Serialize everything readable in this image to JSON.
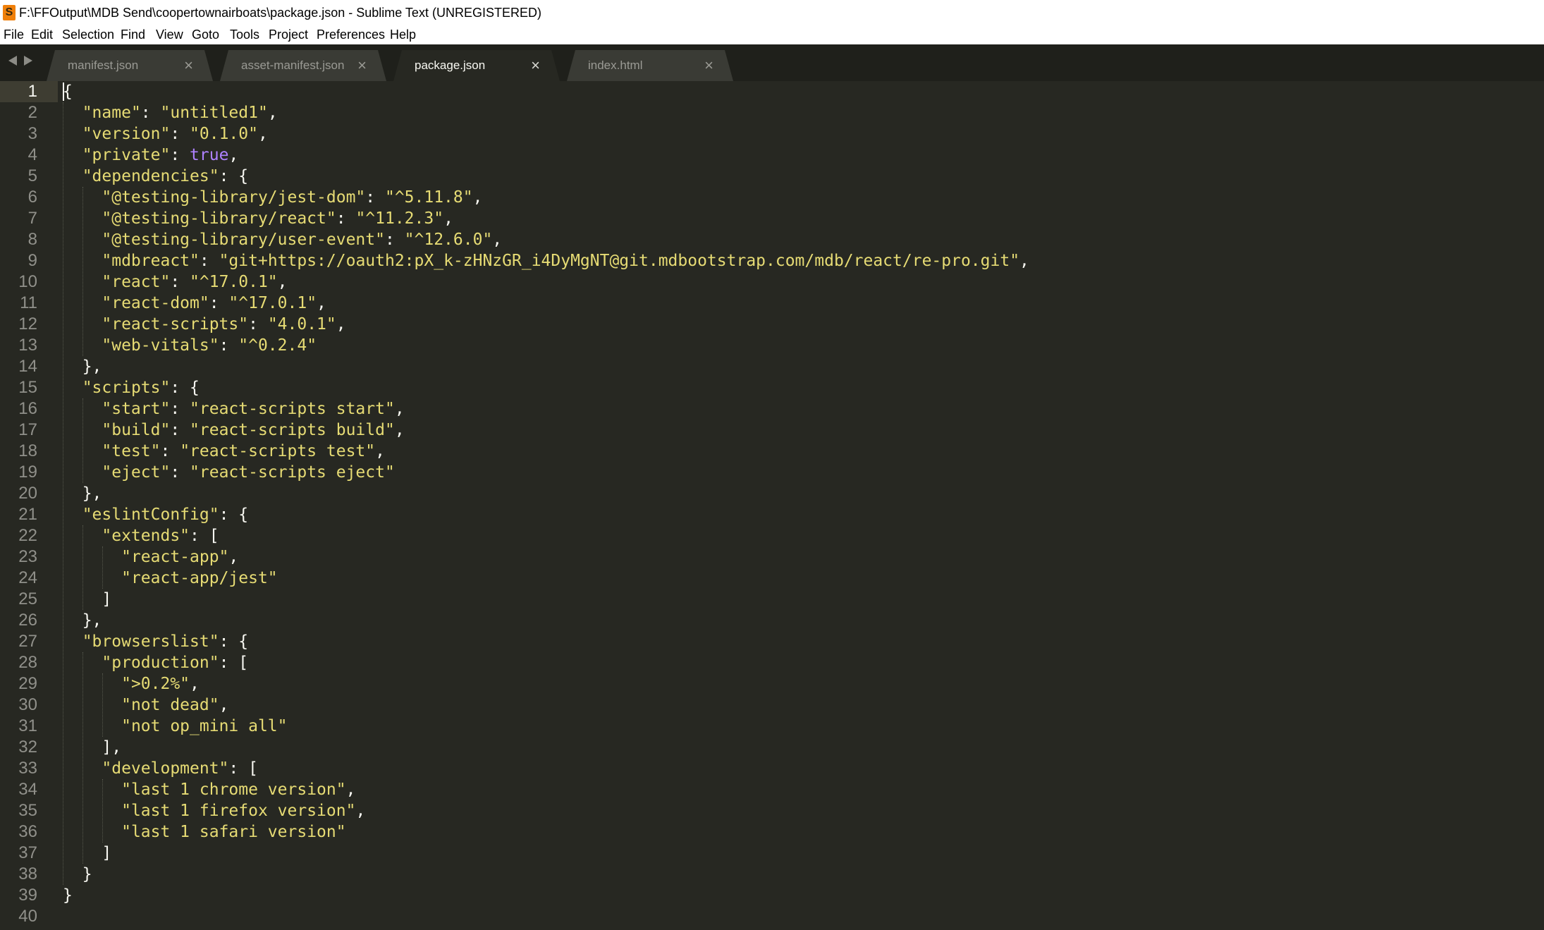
{
  "window": {
    "title": "F:\\FFOutput\\MDB Send\\coopertownairboats\\package.json - Sublime Text (UNREGISTERED)",
    "app_icon": "sublime-text-icon"
  },
  "menu": [
    "File",
    "Edit",
    "Selection",
    "Find",
    "View",
    "Goto",
    "Tools",
    "Project",
    "Preferences",
    "Help"
  ],
  "tabs": [
    {
      "label": "manifest.json",
      "active": false
    },
    {
      "label": "asset-manifest.json",
      "active": false
    },
    {
      "label": "package.json",
      "active": true
    },
    {
      "label": "index.html",
      "active": false
    }
  ],
  "tab_close_glyph": "×",
  "colors": {
    "editor_bg": "#272822",
    "string": "#e6db74",
    "constant": "#ae81ff",
    "text": "#f8f8f2",
    "tab_bar": "#1f201b"
  },
  "editor": {
    "current_line": 1,
    "lines": [
      "{",
      "  \"name\": \"untitled1\",",
      "  \"version\": \"0.1.0\",",
      "  \"private\": true,",
      "  \"dependencies\": {",
      "    \"@testing-library/jest-dom\": \"^5.11.8\",",
      "    \"@testing-library/react\": \"^11.2.3\",",
      "    \"@testing-library/user-event\": \"^12.6.0\",",
      "    \"mdbreact\": \"git+https://oauth2:pX_k-zHNzGR_i4DyMgNT@git.mdbootstrap.com/mdb/react/re-pro.git\",",
      "    \"react\": \"^17.0.1\",",
      "    \"react-dom\": \"^17.0.1\",",
      "    \"react-scripts\": \"4.0.1\",",
      "    \"web-vitals\": \"^0.2.4\"",
      "  },",
      "  \"scripts\": {",
      "    \"start\": \"react-scripts start\",",
      "    \"build\": \"react-scripts build\",",
      "    \"test\": \"react-scripts test\",",
      "    \"eject\": \"react-scripts eject\"",
      "  },",
      "  \"eslintConfig\": {",
      "    \"extends\": [",
      "      \"react-app\",",
      "      \"react-app/jest\"",
      "    ]",
      "  },",
      "  \"browserslist\": {",
      "    \"production\": [",
      "      \">0.2%\",",
      "      \"not dead\",",
      "      \"not op_mini all\"",
      "    ],",
      "    \"development\": [",
      "      \"last 1 chrome version\",",
      "      \"last 1 firefox version\",",
      "      \"last 1 safari version\"",
      "    ]",
      "  }",
      "}",
      ""
    ]
  }
}
